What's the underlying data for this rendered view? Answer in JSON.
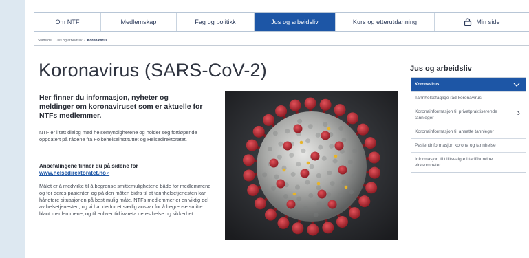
{
  "nav": {
    "items": [
      {
        "label": "Om NTF",
        "active": false
      },
      {
        "label": "Medlemskap",
        "active": false
      },
      {
        "label": "Fag og politikk",
        "active": false
      },
      {
        "label": "Jus og arbeidsliv",
        "active": true
      },
      {
        "label": "Kurs og etterutdanning",
        "active": false
      },
      {
        "label": "Min side",
        "active": false,
        "icon": "lock-icon"
      }
    ]
  },
  "breadcrumb": {
    "items": [
      "Startside",
      "Jus og arbeidsliv",
      "Koronavirus"
    ],
    "separator": "/"
  },
  "main": {
    "title": "Koronavirus (SARS-CoV-2)",
    "lead": "Her finner du informasjon, nyheter og meldinger om koronaviruset som er aktuelle for NTFs medlemmer.",
    "paragraph1": "NTF er i tett dialog med helsemyndighetene og holder seg fortløpende oppdatert på rådene fra Folkehelseinstituttet og Helsedirektoratet.",
    "recommendations_heading": "Anbefalingene finner du på sidene for",
    "recommendations_link": "www.helsedirektoratet.no",
    "paragraph2": "Målet er å medvirke til å begrense smittemulighetene både for medlemmene og for deres pasienter, og på den måten bidra til at tannhelsetjenesten kan håndtere situasjonen på best mulig måte. NTFs medlemmer er en viktig del av helsetjenesten, og vi har derfor et særlig ansvar for å begrense smitte blant medlemmene, og til enhver tid ivareta deres helse og sikkerhet."
  },
  "sidebar": {
    "title": "Jus og arbeidsliv",
    "active_item": "Koronavirus",
    "items": [
      {
        "label": "Tannhelsefaglige råd koronavirus",
        "has_chevron": false
      },
      {
        "label": "Koronainformasjon til privatpraktiserende tannleger",
        "has_chevron": true
      },
      {
        "label": "Koronainformasjon til ansatte tannleger",
        "has_chevron": false
      },
      {
        "label": "Pasientinformasjon korona og tannhelse",
        "has_chevron": false
      },
      {
        "label": "Informasjon til tillitsvalgte i tariffbundne virksomheter",
        "has_chevron": false
      }
    ]
  },
  "colors": {
    "accent": "#1d56a6",
    "background": "#dde8f1"
  }
}
